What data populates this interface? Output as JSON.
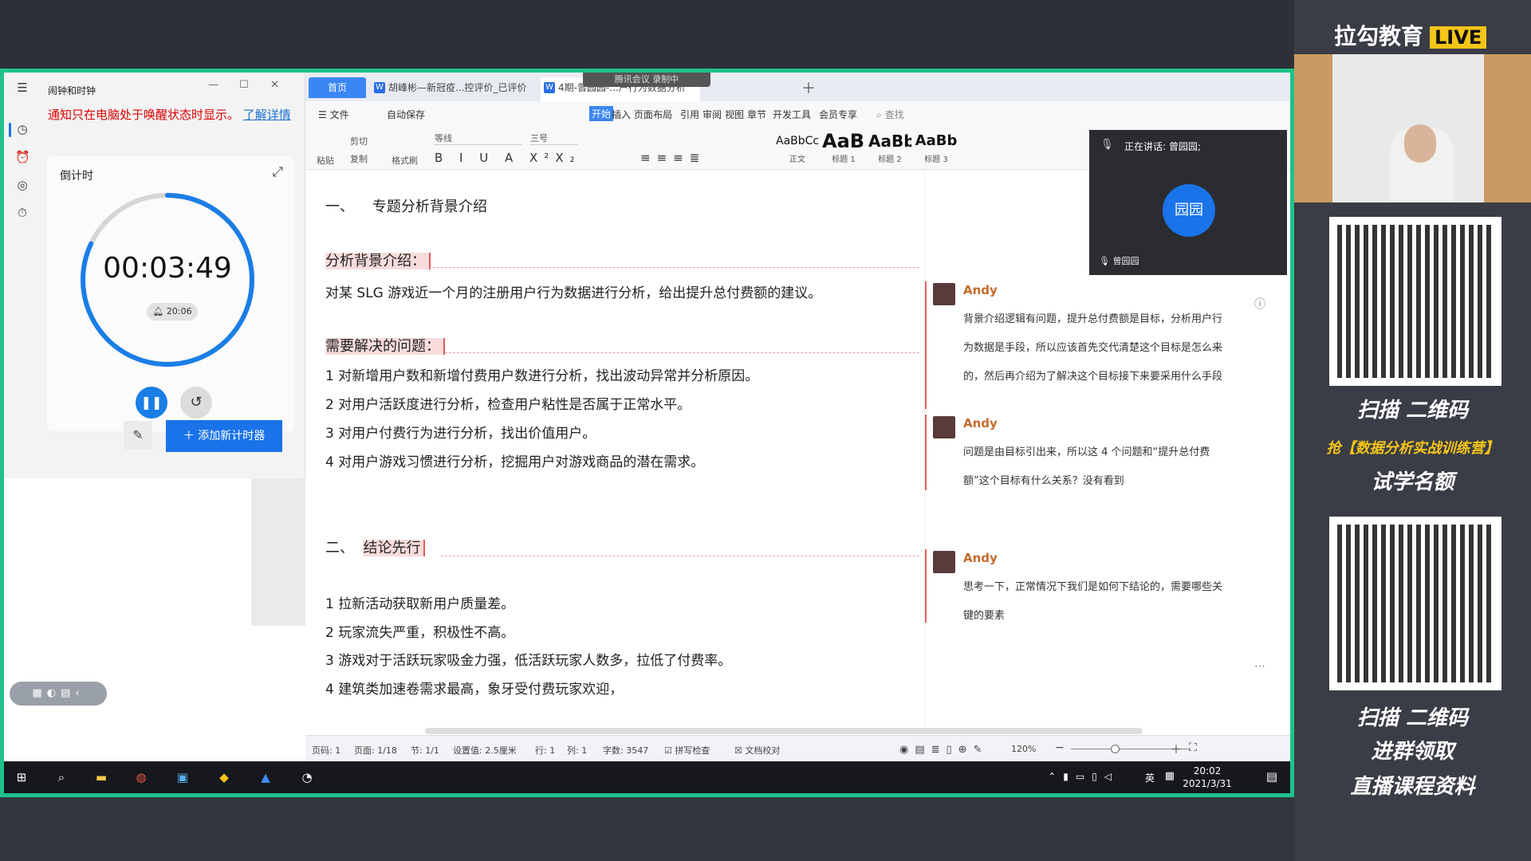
{
  "clock_app": {
    "title": "闹钟和时钟",
    "notice": "通知只在电脑处于唤醒状态时显示。",
    "notice_link": "了解详情",
    "timer_label": "倒计时",
    "time": "00:03:49",
    "alarm_time": "20:06",
    "progress_fraction": 0.82,
    "add_timer": "添加新计时器"
  },
  "wps": {
    "tab_home": "首页",
    "tabs": [
      "胡峰彬—新冠疫...控评价_已评价",
      "4期-曾园园-...户行为数据分析"
    ],
    "meeting_badge": "腾讯会议  录制中",
    "menus": [
      "文件",
      "自动保存",
      "开始",
      "插入",
      "页面布局",
      "引用",
      "审阅",
      "视图",
      "章节",
      "开发工具",
      "会员专享",
      "查找"
    ],
    "ribbon": {
      "paste": "粘贴",
      "cut": "剪切",
      "copy": "复制",
      "format_painter": "格式刷",
      "font": "等线",
      "size": "三号"
    },
    "styles": [
      {
        "sample": "AaBbCcD",
        "name": "正文"
      },
      {
        "sample": "AaBl",
        "name": "标题 1"
      },
      {
        "sample": "AaBb(",
        "name": "标题 2"
      },
      {
        "sample": "AaBb",
        "name": "标题 3"
      }
    ],
    "doc": {
      "h1_num": "一、",
      "h1": "专题分析背景介绍",
      "sec1_title": "分析背景介绍：",
      "sec1_body": "对某 SLG 游戏近一个月的注册用户行为数据进行分析，给出提升总付费额的建议。",
      "sec2_title": "需要解决的问题：",
      "problems": [
        "1 对新增用户数和新增付费用户数进行分析，找出波动异常并分析原因。",
        "2 对用户活跃度进行分析，检查用户粘性是否属于正常水平。",
        "3 对用户付费行为进行分析，找出价值用户。",
        "4 对用户游戏习惯进行分析，挖掘用户对游戏商品的潜在需求。"
      ],
      "h2_num": "二、",
      "h2": "结论先行",
      "conclusions": [
        "1 拉新活动获取新用户质量差。",
        "2 玩家流失严重，积极性不高。",
        "3 游戏对于活跃玩家吸金力强，低活跃玩家人数多，拉低了付费率。",
        "4 建筑类加速卷需求最高，象牙受付费玩家欢迎，"
      ]
    },
    "comments": [
      {
        "author": "Andy",
        "text": "背景介绍逻辑有问题，提升总付费额是目标，分析用户行为数据是手段，所以应该首先交代清楚这个目标是怎么来的，然后再介绍为了解决这个目标接下来要采用什么手段"
      },
      {
        "author": "Andy",
        "text": "问题是由目标引出来，所以这 4 个问题和“提升总付费额”这个目标有什么关系？没有看到"
      },
      {
        "author": "Andy",
        "text": "思考一下，正常情况下我们是如何下结论的，需要哪些关键的要素"
      }
    ],
    "status": {
      "page_num": "页码: 1",
      "pages": "页面: 1/18",
      "section": "节: 1/1",
      "setting": "设置值: 2.5厘米",
      "row": "行: 1",
      "col": "列: 1",
      "words": "字数: 3547",
      "spell": "拼写检查",
      "proof": "文档校对",
      "zoom": "120%"
    }
  },
  "meeting": {
    "speaking": "正在讲话: 曾园园;",
    "avatar_name": "园园",
    "name": "曾园园"
  },
  "taskbar": {
    "ime": "英",
    "time": "20:02",
    "date": "2021/3/31"
  },
  "promo": {
    "brand": "拉勾教育",
    "live": "LIVE",
    "scan1": "扫描  二维码",
    "offer": "抢【数据分析实战训练营】",
    "trial": "试学名额",
    "scan2": "扫描  二维码",
    "join": "进群领取",
    "material": "直播课程资料"
  },
  "colors": {
    "accent": "#1a73e8",
    "frame": "#1fc28a",
    "comment_author": "#c46a2d",
    "highlight": "#f8dcdc"
  }
}
